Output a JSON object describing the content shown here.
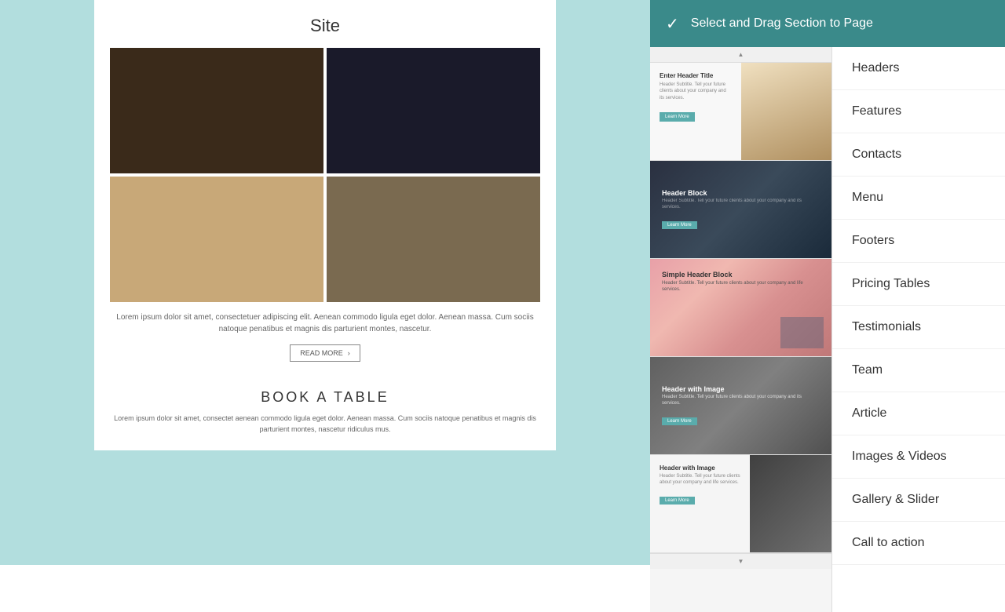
{
  "header": {
    "title": "Select and Drag Section to Page",
    "check_label": "✓"
  },
  "content": {
    "site_title": "Site",
    "lorem_text": "Lorem ipsum dolor sit amet, consectetuer adipiscing elit. Aenean commodo ligula eget dolor. Aenean massa. Cum sociis natoque penatibus et magnis dis parturient montes, nascetur.",
    "read_more_label": "READ MORE",
    "book_title": "BOOK A TABLE",
    "book_text": "Lorem ipsum dolor sit amet, consectet aenean commodo ligula eget dolor. Aenean massa. Cum sociis natoque penatibus et magnis dis parturient montes, nascetur ridiculus mus."
  },
  "thumbnails": [
    {
      "id": "thumb-1",
      "title": "Enter Header Title",
      "subtitle": "Header Subtitle. Tell your future clients about your company and its services.",
      "btn_label": "Learn More"
    },
    {
      "id": "thumb-2",
      "title": "Header Block",
      "subtitle": "Header Subtitle. Tell your future clients about your company and its services.",
      "btn_label": "Learn More"
    },
    {
      "id": "thumb-3",
      "title": "Simple Header Block",
      "subtitle": "Header Subtitle. Tell your future clients about your company and life services."
    },
    {
      "id": "thumb-4",
      "title": "Header with Image",
      "subtitle": "Header Subtitle. Tell your future clients about your company and its services.",
      "btn_label": "Learn More"
    },
    {
      "id": "thumb-5",
      "title": "Header with Image",
      "subtitle": "Header Subtitle. Tell your future clients about your company and life services.",
      "btn_label": "Learn More"
    }
  ],
  "categories": [
    {
      "id": "cat-headers",
      "label": "Headers"
    },
    {
      "id": "cat-features",
      "label": "Features"
    },
    {
      "id": "cat-contacts",
      "label": "Contacts"
    },
    {
      "id": "cat-menu",
      "label": "Menu"
    },
    {
      "id": "cat-footers",
      "label": "Footers"
    },
    {
      "id": "cat-pricing",
      "label": "Pricing Tables"
    },
    {
      "id": "cat-testimonials",
      "label": "Testimonials"
    },
    {
      "id": "cat-team",
      "label": "Team"
    },
    {
      "id": "cat-article",
      "label": "Article"
    },
    {
      "id": "cat-images",
      "label": "Images & Videos"
    },
    {
      "id": "cat-gallery",
      "label": "Gallery & Slider"
    },
    {
      "id": "cat-cta",
      "label": "Call to action"
    }
  ],
  "icons": {
    "check": "✓",
    "arrow_right": "›",
    "chevron_up": "▲",
    "chevron_down": "▼"
  },
  "colors": {
    "teal": "#3a8a8a",
    "teal_light": "#5aacac",
    "bg_light": "#b2dede"
  }
}
